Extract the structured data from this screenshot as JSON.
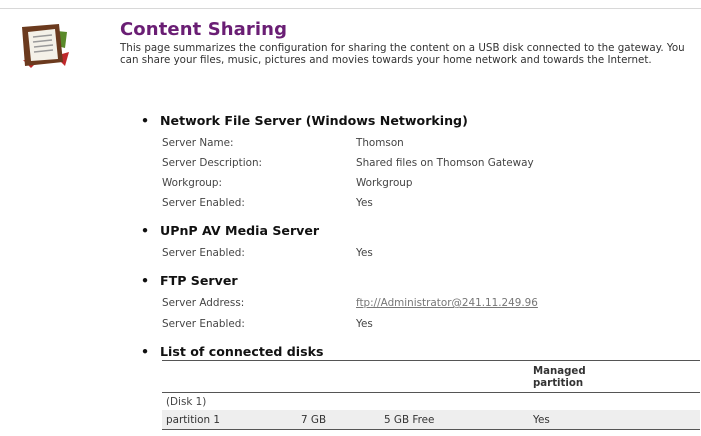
{
  "page": {
    "title": "Content Sharing",
    "intro": "This page summarizes the configuration for sharing the content on a USB disk connected to the gateway. You can share your files, music, pictures and movies towards your home network and towards the Internet."
  },
  "network_file_server": {
    "heading": "Network File Server (Windows Networking)",
    "rows": [
      {
        "label": "Server Name:",
        "value": "Thomson"
      },
      {
        "label": "Server Description:",
        "value": "Shared files on Thomson Gateway"
      },
      {
        "label": "Workgroup:",
        "value": "Workgroup"
      },
      {
        "label": "Server Enabled:",
        "value": "Yes"
      }
    ]
  },
  "upnp_server": {
    "heading": "UPnP AV Media Server",
    "rows": [
      {
        "label": "Server Enabled:",
        "value": "Yes"
      }
    ]
  },
  "ftp_server": {
    "heading": "FTP Server",
    "rows": [
      {
        "label": "Server Address:",
        "value": "ftp://Administrator@241.11.249.96"
      },
      {
        "label": "Server Enabled:",
        "value": "Yes"
      }
    ]
  },
  "disks": {
    "heading": "List of connected disks",
    "managed_header": [
      "Managed",
      "partition"
    ],
    "group_label": "(Disk 1)",
    "partitions": [
      {
        "name": "partition 1",
        "size": "7 GB",
        "free": "5 GB Free",
        "managed": "Yes"
      }
    ]
  },
  "colors": {
    "title": "#6a1e74",
    "row_stripe": "#eeeeee"
  },
  "icons": {
    "page_icon": "content-sharing-icon"
  }
}
